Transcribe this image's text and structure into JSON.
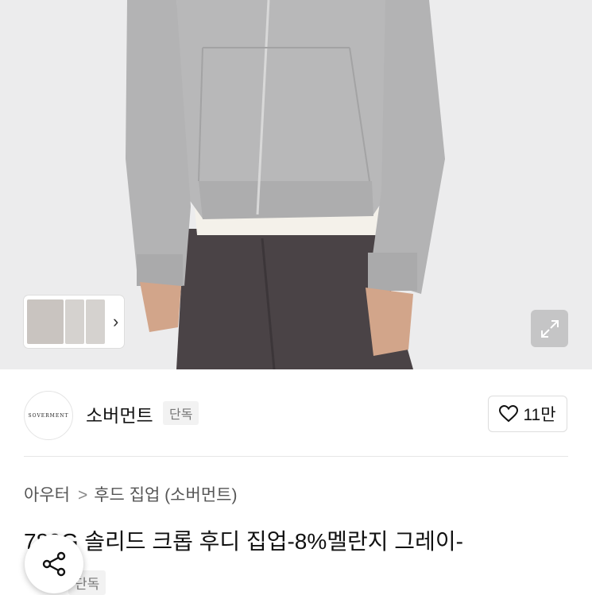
{
  "product": {
    "thumbnails": [
      {
        "alt": "thumbnail-1"
      },
      {
        "alt": "thumbnail-2"
      },
      {
        "alt": "thumbnail-3"
      }
    ]
  },
  "brand": {
    "logo_text": "SOVERMENT",
    "name": "소버먼트",
    "badge": "단독"
  },
  "like": {
    "count": "11만"
  },
  "breadcrumb": {
    "level1": "아우터",
    "separator": ">",
    "level2": "후드 집업 (소버먼트)"
  },
  "title": "780G 솔리드 크롭 후디 집업-8%멜란지 그레이-",
  "bottom_badge": "단독",
  "colors": {
    "hoodie": "#b9b9b9",
    "pants": "#4a4346",
    "hero_bg": "#ececed"
  }
}
